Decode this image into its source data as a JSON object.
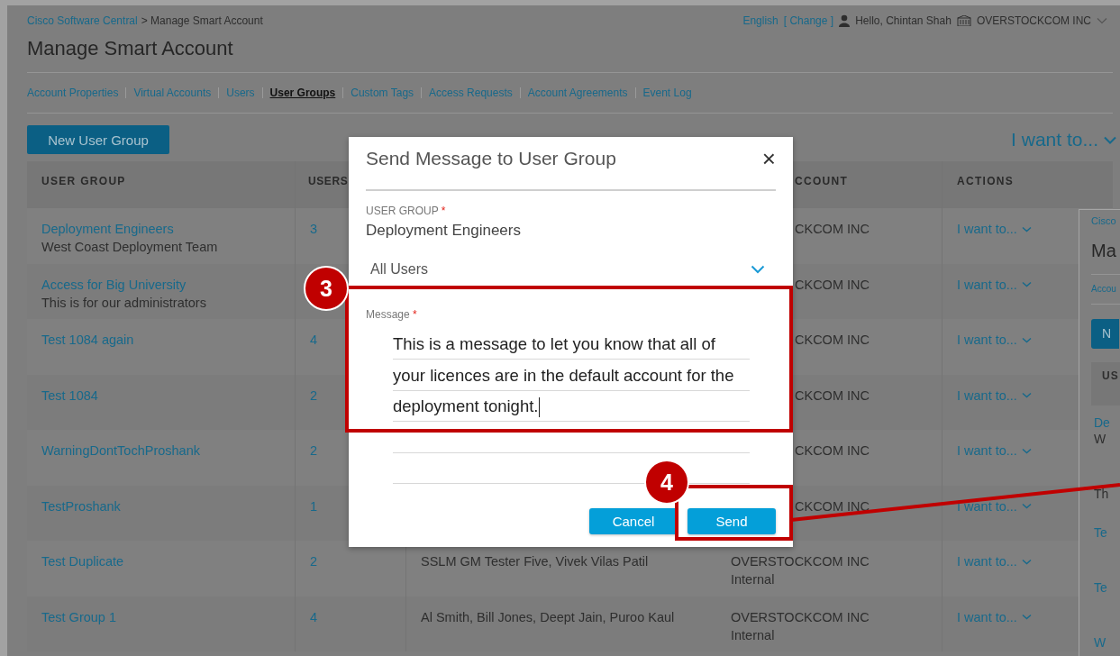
{
  "header": {
    "breadcrumb_link": "Cisco Software Central",
    "breadcrumb_current": "> Manage Smart Account",
    "language": "English",
    "change_link": "[ Change ]",
    "greeting": "Hello, Chintan Shah",
    "account": "OVERSTOCKCOM INC"
  },
  "page_title": "Manage Smart Account",
  "tabs": [
    {
      "label": "Account Properties",
      "selected": false
    },
    {
      "label": "Virtual Accounts",
      "selected": false
    },
    {
      "label": "Users",
      "selected": false
    },
    {
      "label": "User Groups",
      "selected": true
    },
    {
      "label": "Custom Tags",
      "selected": false
    },
    {
      "label": "Access Requests",
      "selected": false
    },
    {
      "label": "Account Agreements",
      "selected": false
    },
    {
      "label": "Event Log",
      "selected": false
    }
  ],
  "new_button": "New User Group",
  "actions_menu": "I want to...",
  "table": {
    "headers": {
      "user_group": "USER GROUP",
      "users": "USERS",
      "account": "CCOUNT",
      "actions": "ACTIONS"
    },
    "rows": [
      {
        "name": "Deployment Engineers",
        "description": "West Coast Deployment Team",
        "users": "3",
        "account": "CKCOM INC",
        "action": "I want to..."
      },
      {
        "name": "Access for Big University",
        "description": "This is for our administrators",
        "account": "CKCOM INC",
        "action": "I want to..."
      },
      {
        "name": "Test 1084 again",
        "users": "4",
        "account": "CKCOM INC",
        "action": "I want to..."
      },
      {
        "name": "Test 1084",
        "users": "2",
        "account": "CKCOM INC",
        "action": "I want to..."
      },
      {
        "name": "WarningDontTochProshank",
        "users": "2",
        "account": "CKCOM INC",
        "action": "I want to..."
      },
      {
        "name": "TestProshank",
        "users": "1",
        "account": "CKCOM INC",
        "action": "I want to..."
      },
      {
        "name": "Test Duplicate",
        "users": "2",
        "members": "SSLM GM Tester Five, Vivek Vilas Patil",
        "account": "OVERSTOCKCOM INC",
        "account_type": "Internal",
        "action": "I want to..."
      },
      {
        "name": "Test Group 1",
        "users": "4",
        "members": "Al Smith, Bill Jones, Deept Jain, Puroo Kaul",
        "account": "OVERSTOCKCOM INC",
        "account_type": "Internal",
        "action": "I want to..."
      }
    ]
  },
  "modal": {
    "title": "Send Message to User Group",
    "close": "×",
    "group_label": "USER GROUP",
    "required_mark": "*",
    "group_value": "Deployment Engineers",
    "recipients": "All Users",
    "message_label": "Message",
    "message_required_mark": "*",
    "message": "This is a message to let you know that all of your licences are in the default account for the deployment tonight.",
    "focused": true,
    "buttons": [
      "Cancel",
      "Send"
    ]
  },
  "callouts": {
    "message": "3",
    "send": "4"
  },
  "inset": {
    "link": "Cisco",
    "title": "Ma",
    "tab": "Accou",
    "button": "N",
    "column": "US",
    "rows": [
      {
        "name": "De",
        "description": "W"
      },
      {
        "description": "Th"
      },
      {
        "name": "Te"
      },
      {
        "name": "Te"
      },
      {
        "name": "W"
      }
    ]
  }
}
